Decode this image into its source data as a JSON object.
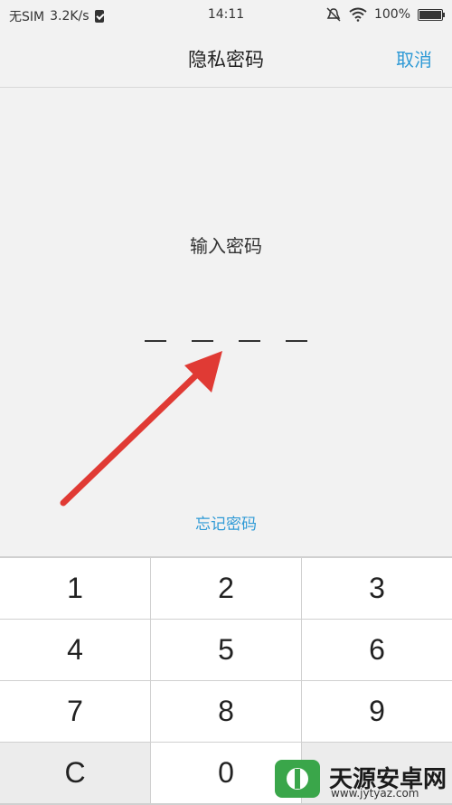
{
  "status_bar": {
    "carrier": "无SIM",
    "speed": "3.2K/s",
    "time": "14:11",
    "battery": "100%",
    "battery_level": 1.0
  },
  "header": {
    "title": "隐私密码",
    "cancel": "取消"
  },
  "prompt": "输入密码",
  "dashes": 4,
  "forgot": "忘记密码",
  "keypad": {
    "keys": [
      "1",
      "2",
      "3",
      "4",
      "5",
      "6",
      "7",
      "8",
      "9",
      "C",
      "0",
      ""
    ]
  },
  "watermark": {
    "brand": "天源安卓网",
    "url": "www.jytyaz.com"
  },
  "colors": {
    "accent": "#2f9ad6",
    "arrow": "#e03a34"
  }
}
